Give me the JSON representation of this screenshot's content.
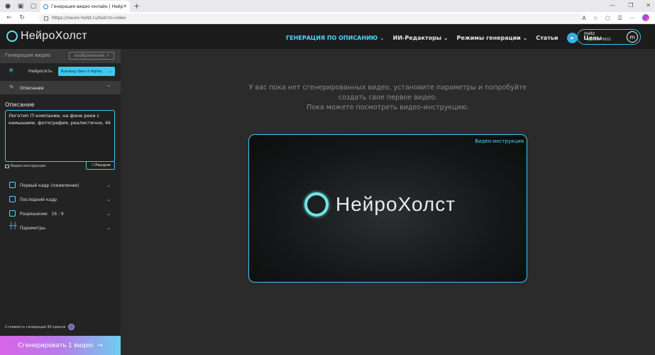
{
  "browser": {
    "tab_title": "Генерация видео онлайн | Нейр",
    "url": "https://neuro-holst.ru/text-to-video"
  },
  "header": {
    "logo": "НейроХолст",
    "nav": [
      {
        "label": "ГЕНЕРАЦИЯ ПО ОПИСАНИЮ",
        "active": true
      },
      {
        "label": "ИИ-Редакторы"
      },
      {
        "label": "Режимы генерации"
      },
      {
        "label": "Статьи"
      },
      {
        "label": "Цены"
      }
    ],
    "user": {
      "name": "metz",
      "credits": "Красок 9802",
      "avatar_letter": "m"
    }
  },
  "sidebar": {
    "title": "Генерация видео",
    "images_button": "изображения ↗",
    "network_label": "Нейросеть",
    "network_value": "Runway Gen-3 Alpha",
    "description_section": "Описание",
    "description_title": "Описание",
    "description_text": "Логотип IT-компании, на фоне реки с камышами, фотография, реалистично, 4k",
    "video_guide_link": "Видео-инструкция",
    "random_button": "Рандом",
    "first_frame": "Первый кадр (оживление)",
    "last_frame": "Последний кадр",
    "resolution_label": "Разрешение",
    "resolution_value": "16 : 9",
    "parameters": "Параметры",
    "cost_text": "Стоимость генерации 90 красок",
    "generate_button": "Сгенерировать 1 видео"
  },
  "main": {
    "empty_line1": "У вас пока нет сгенерированных видео, установите параметры и попробуйте",
    "empty_line2": "создать свое первое видео.",
    "empty_line3": "Пока можете посмотреть видео-инструкцию.",
    "video_label": "Видео-инструкция",
    "video_brand": "НейроХолст"
  },
  "colors": {
    "accent": "#3cc9ef",
    "sidebar_bg": "#232323",
    "main_bg": "#2b2b2b"
  }
}
